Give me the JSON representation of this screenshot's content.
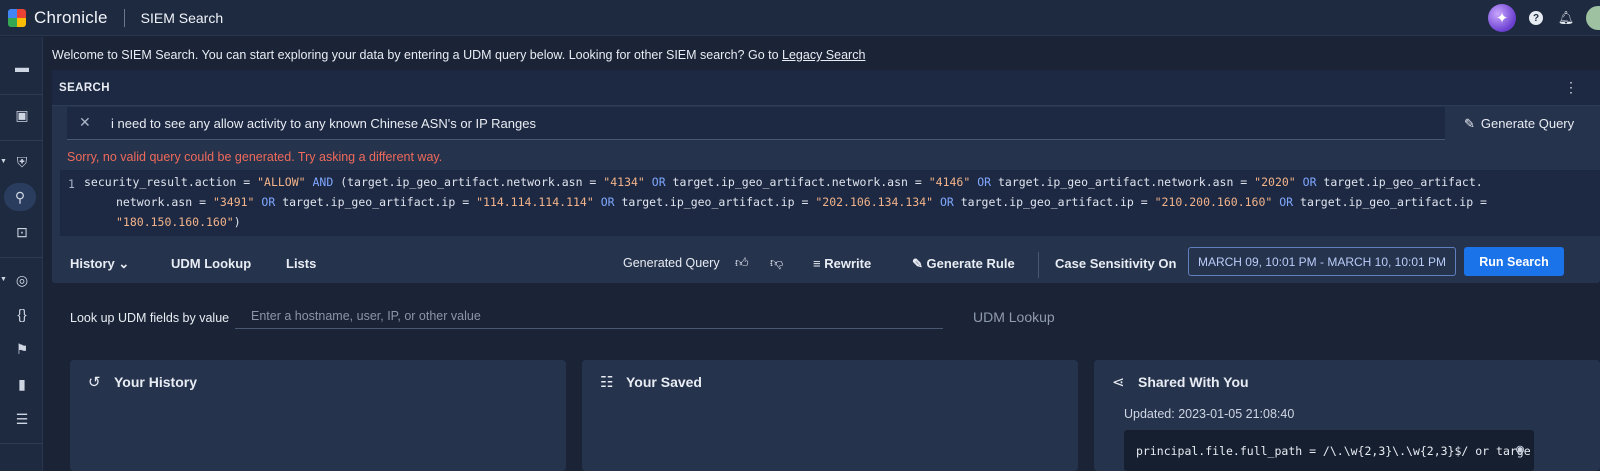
{
  "header": {
    "brand": "Chronicle",
    "product": "SIEM Search"
  },
  "welcome": {
    "text": "Welcome to SIEM Search. You can start exploring your data by entering a UDM query below. Looking for other SIEM search? Go to ",
    "link": "Legacy Search"
  },
  "search": {
    "title": "SEARCH",
    "prompt": "i need to see any allow activity to any known Chinese ASN's or IP Ranges",
    "generate_query_label": "Generate Query",
    "error": "Sorry, no valid query could be generated. Try asking a different way.",
    "line_number": "1",
    "code_lines": [
      [
        {
          "t": "security_result.action = ",
          "c": ""
        },
        {
          "t": "\"ALLOW\"",
          "c": "s"
        },
        {
          "t": " AND ",
          "c": "k"
        },
        {
          "t": "(target.ip_geo_artifact.network.asn = ",
          "c": ""
        },
        {
          "t": "\"4134\"",
          "c": "s"
        },
        {
          "t": " OR ",
          "c": "k"
        },
        {
          "t": "target.ip_geo_artifact.network.asn = ",
          "c": ""
        },
        {
          "t": "\"4146\"",
          "c": "s"
        },
        {
          "t": " OR ",
          "c": "k"
        },
        {
          "t": "target.ip_geo_artifact.network.asn = ",
          "c": ""
        },
        {
          "t": "\"2020\"",
          "c": "s"
        },
        {
          "t": " OR ",
          "c": "k"
        },
        {
          "t": "target.ip_geo_artifact.",
          "c": ""
        }
      ],
      [
        {
          "t": "network.asn = ",
          "c": ""
        },
        {
          "t": "\"3491\"",
          "c": "s"
        },
        {
          "t": " OR ",
          "c": "k"
        },
        {
          "t": "target.ip_geo_artifact.ip = ",
          "c": ""
        },
        {
          "t": "\"114.114.114.114\"",
          "c": "s"
        },
        {
          "t": " OR ",
          "c": "k"
        },
        {
          "t": "target.ip_geo_artifact.ip = ",
          "c": ""
        },
        {
          "t": "\"202.106.134.134\"",
          "c": "s"
        },
        {
          "t": " OR ",
          "c": "k"
        },
        {
          "t": "target.ip_geo_artifact.ip = ",
          "c": ""
        },
        {
          "t": "\"210.200.160.160\"",
          "c": "s"
        },
        {
          "t": " OR ",
          "c": "k"
        },
        {
          "t": "target.ip_geo_artifact.ip =",
          "c": ""
        }
      ],
      [
        {
          "t": "\"180.150.160.160\"",
          "c": "s"
        },
        {
          "t": ")",
          "c": ""
        }
      ]
    ]
  },
  "toolbar": {
    "history": "History",
    "udm_lookup": "UDM Lookup",
    "lists": "Lists",
    "generated_query": "Generated Query",
    "rewrite": "Rewrite",
    "generate_rule": "Generate Rule",
    "case_sensitivity": "Case Sensitivity On",
    "date_range": "MARCH 09, 10:01 PM - MARCH 10, 10:01 PM",
    "run_search": "Run Search"
  },
  "lookup": {
    "label": "Look up UDM fields by value",
    "placeholder": "Enter a hostname, user, IP, or other value",
    "button": "UDM Lookup"
  },
  "cards": {
    "history_title": "Your History",
    "saved_title": "Your Saved",
    "shared_title": "Shared With You",
    "shared_updated": "Updated: 2023-01-05 21:08:40",
    "shared_query": "principal.file.full_path = /\\.\\w{2,3}\\.\\w{2,3}$/ or targe"
  },
  "icons": {
    "gemini": "sparkle-icon",
    "help": "help-icon",
    "notifications": "bell-icon"
  },
  "colors": {
    "accent": "#1a73e8",
    "error": "#ef6a5a",
    "keyword": "#7fa7ff",
    "string": "#f2b38a"
  }
}
